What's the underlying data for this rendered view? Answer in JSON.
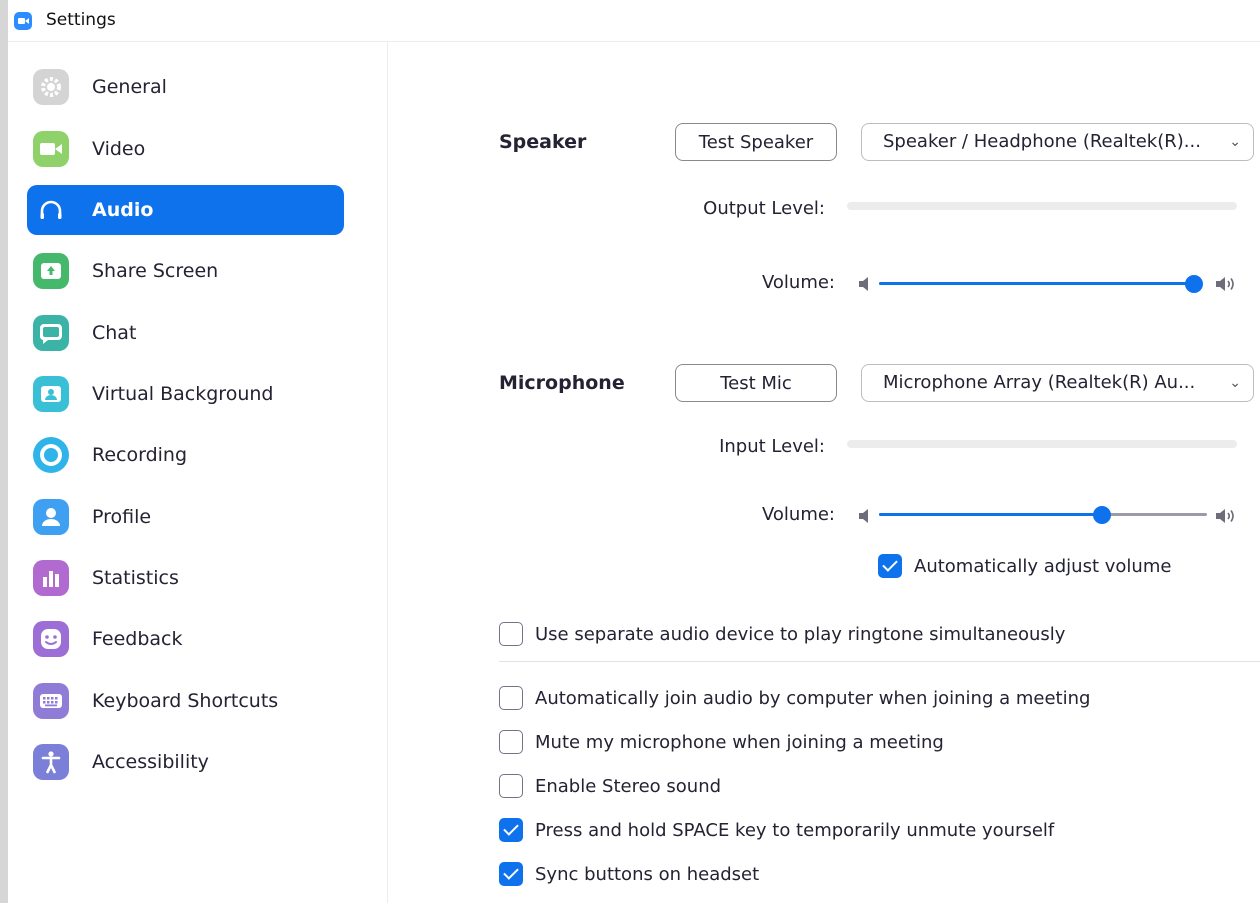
{
  "window": {
    "title": "Settings",
    "app_icon": "zoom-camera-icon"
  },
  "sidebar": {
    "active_index": 2,
    "items": [
      {
        "label": "General",
        "icon": "gear-icon",
        "color": "#cfcfcf"
      },
      {
        "label": "Video",
        "icon": "video-camera-icon",
        "color": "#8fd16a"
      },
      {
        "label": "Audio",
        "icon": "headphones-icon",
        "color": "#0e72ed"
      },
      {
        "label": "Share Screen",
        "icon": "share-screen-icon",
        "color": "#46b86c"
      },
      {
        "label": "Chat",
        "icon": "chat-bubble-icon",
        "color": "#3bb3a7"
      },
      {
        "label": "Virtual Background",
        "icon": "virtual-background-icon",
        "color": "#3ac0d6"
      },
      {
        "label": "Recording",
        "icon": "record-icon",
        "color": "#2fb4ea"
      },
      {
        "label": "Profile",
        "icon": "profile-icon",
        "color": "#3f9ff0"
      },
      {
        "label": "Statistics",
        "icon": "bar-chart-icon",
        "color": "#b06ad0"
      },
      {
        "label": "Feedback",
        "icon": "smiley-icon",
        "color": "#9d6fd6"
      },
      {
        "label": "Keyboard Shortcuts",
        "icon": "keyboard-icon",
        "color": "#8e7cd6"
      },
      {
        "label": "Accessibility",
        "icon": "accessibility-icon",
        "color": "#7b7fd8"
      }
    ]
  },
  "speaker": {
    "label": "Speaker",
    "test_button": "Test Speaker",
    "device": "Speaker / Headphone (Realtek(R)...",
    "output_level_label": "Output Level:",
    "volume_label": "Volume:",
    "volume": 1.0
  },
  "microphone": {
    "label": "Microphone",
    "test_button": "Test Mic",
    "device": "Microphone Array (Realtek(R) Au...",
    "input_level_label": "Input Level:",
    "volume_label": "Volume:",
    "volume": 0.68,
    "auto_adjust": {
      "label": "Automatically adjust volume",
      "checked": true
    }
  },
  "options": {
    "separate_ringtone": {
      "label": "Use separate audio device to play ringtone simultaneously",
      "checked": false
    },
    "auto_join": {
      "label": "Automatically join audio by computer when joining a meeting",
      "checked": false
    },
    "mute_on_join": {
      "label": "Mute my microphone when joining a meeting",
      "checked": false
    },
    "stereo": {
      "label": "Enable Stereo sound",
      "checked": false
    },
    "space_unmute": {
      "label": "Press and hold SPACE key to temporarily unmute yourself",
      "checked": true
    },
    "sync_headset": {
      "label": "Sync buttons on headset",
      "checked": true
    }
  },
  "colors": {
    "accent": "#0e72ed",
    "text": "#232333"
  }
}
